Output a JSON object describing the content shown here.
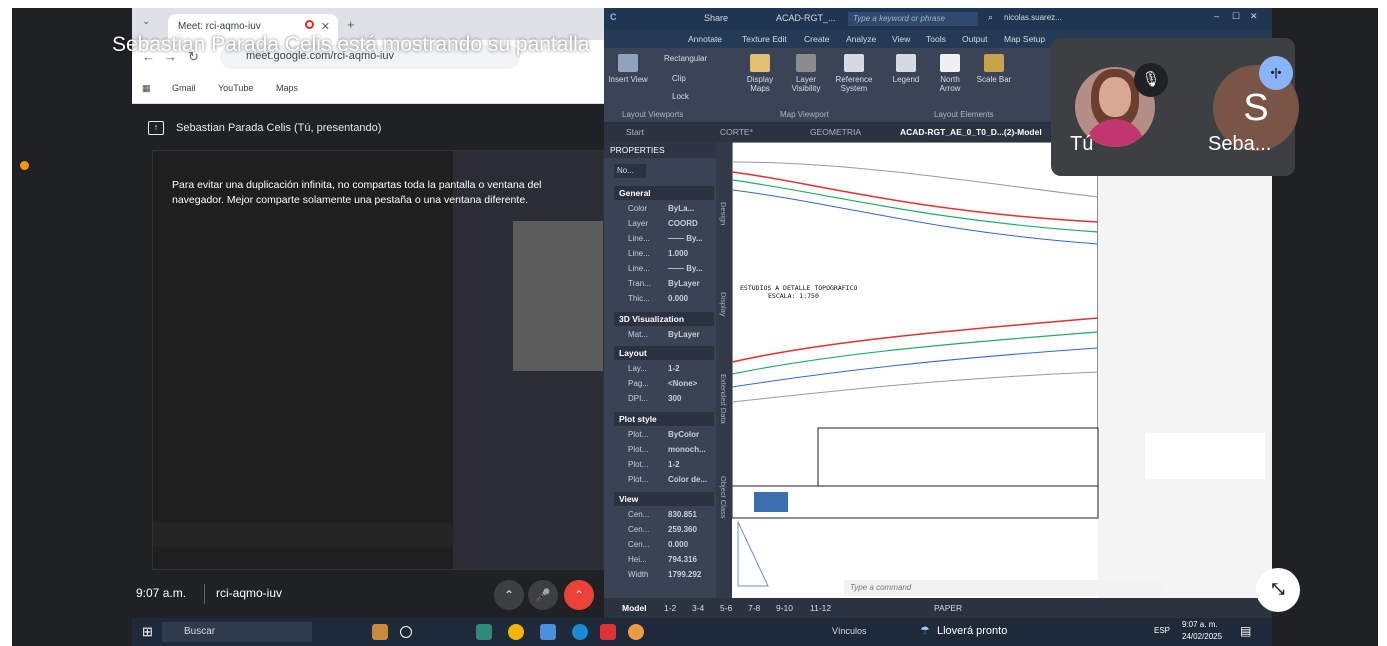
{
  "presenter_banner": "Sebastian Parada Celis está mostrando su pantalla",
  "browser": {
    "tab_title": "Meet: rci-aqmo-iuv",
    "url": "meet.google.com/rci-aqmo-iuv",
    "bookmarks": [
      "Gmail",
      "YouTube",
      "Maps"
    ]
  },
  "meet": {
    "presenting_label": "Sebastian Parada Celis (Tú, presentando)",
    "warning": "Para evitar una duplicación infinita, no compartas toda la pantalla o ventana del navegador. Mejor comparte solamente una pestaña o una ventana diferente.",
    "time": "9:07 a.m.",
    "meeting_code": "rci-aqmo-iuv"
  },
  "participants": [
    {
      "name": "Tú",
      "muted": true
    },
    {
      "name": "Seba...",
      "initial": "S",
      "speaking": true
    }
  ],
  "autocad": {
    "title": "ACAD-RGT_...",
    "search_placeholder": "Type a keyword or phrase",
    "user": "nicolas.suarez...",
    "share": "Share",
    "ribbon_tabs": [
      "Annotate",
      "Texture Edit",
      "Create",
      "Analyze",
      "View",
      "Tools",
      "Output",
      "Map Setup"
    ],
    "ribbon_buttons": [
      "Rectangular",
      "Clip",
      "Lock",
      "Insert View",
      "Display Maps",
      "Layer Visibility",
      "Reference System",
      "Legend",
      "North Arrow",
      "Scale Bar"
    ],
    "ribbon_groups": [
      "Layout Viewports",
      "Map Viewport",
      "Layout Elements"
    ],
    "doc_tabs": [
      "Start",
      "CORTE*",
      "GEOMETRIA",
      "ACAD-RGT_AE_0_T0_D...(2)-Model"
    ],
    "properties_title": "PROPERTIES",
    "properties_selector": "No...",
    "sections": {
      "general": {
        "title": "General",
        "rows": [
          [
            "Color",
            "ByLa..."
          ],
          [
            "Layer",
            "COORD"
          ],
          [
            "Line...",
            "—— By..."
          ],
          [
            "Line...",
            "1.000"
          ],
          [
            "Line...",
            "—— By..."
          ],
          [
            "Tran...",
            "ByLayer"
          ],
          [
            "Thic...",
            "0.000"
          ]
        ]
      },
      "viz": {
        "title": "3D Visualization",
        "rows": [
          [
            "Mat...",
            "ByLayer"
          ]
        ]
      },
      "layout": {
        "title": "Layout",
        "rows": [
          [
            "Lay...",
            "1-2"
          ],
          [
            "Pag...",
            "<None>"
          ],
          [
            "DPI...",
            "300"
          ]
        ]
      },
      "plot": {
        "title": "Plot style",
        "rows": [
          [
            "Plot...",
            "ByColor"
          ],
          [
            "Plot...",
            "monoch..."
          ],
          [
            "Plot...",
            "1-2"
          ],
          [
            "Plot...",
            "Color de..."
          ]
        ]
      },
      "view": {
        "title": "View",
        "rows": [
          [
            "Cen...",
            "830.851"
          ],
          [
            "Cen...",
            "259.360"
          ],
          [
            "Cen...",
            "0.000"
          ],
          [
            "Hei...",
            "794.316"
          ],
          [
            "Width",
            "1799.292"
          ]
        ]
      }
    },
    "side_tabs": [
      "Design",
      "Display",
      "Extended Data",
      "Object Class"
    ],
    "drawing_title": "ESTUDIOS A DETALLE TOPOGRAFICO",
    "drawing_scale": "ESCALA: 1:750",
    "command_placeholder": "Type a command",
    "layout_tabs": [
      "Model",
      "1-2",
      "3-4",
      "5-6",
      "7-8",
      "9-10",
      "11-12"
    ],
    "paper": "PAPER"
  },
  "taskbar": {
    "search": "Buscar",
    "links": "Vínculos",
    "weather": "Lloverá pronto",
    "lang": "ESP",
    "time": "9:07 a. m.",
    "date": "24/02/2025"
  }
}
